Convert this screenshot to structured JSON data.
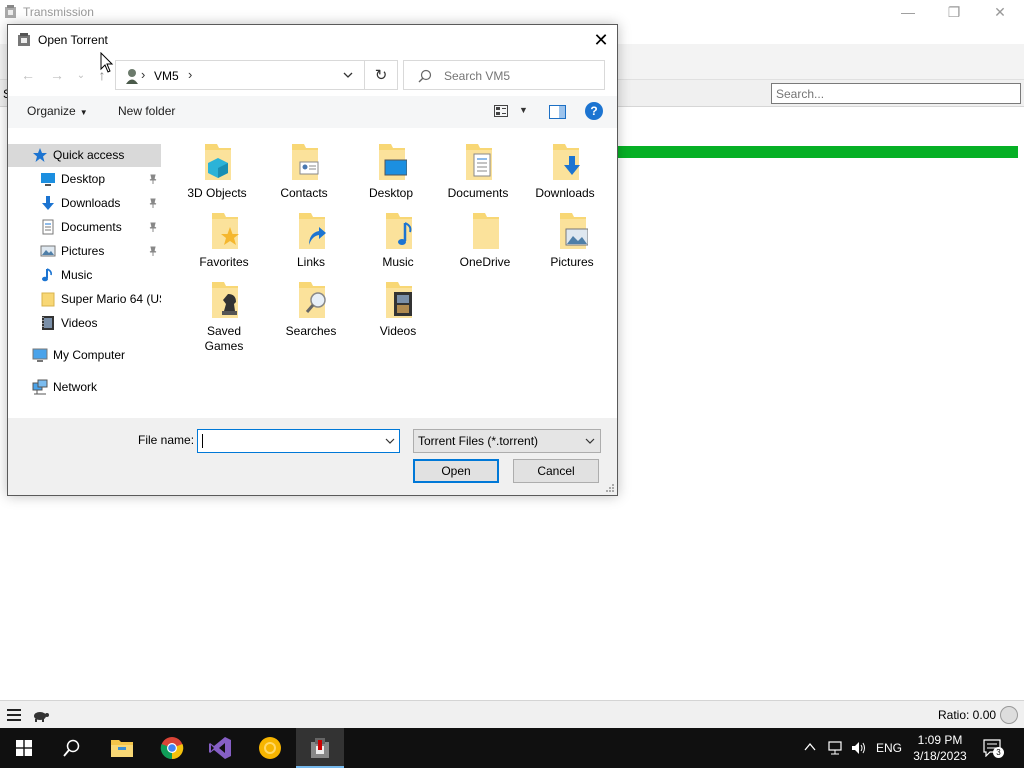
{
  "background_app": {
    "title": "Transmission",
    "filter_partial": "S",
    "search_placeholder": "Search...",
    "progress_fraction": 1.0,
    "ratio_text": "Ratio: 0.00",
    "accent": "#06b025"
  },
  "dialog": {
    "title": "Open Torrent",
    "close_label": "✕",
    "nav": {
      "back": "←",
      "forward": "→",
      "recent": "⌄",
      "up": "↑",
      "path_segment": "VM5",
      "sep": "›",
      "refresh": "↻",
      "search_placeholder": "Search VM5"
    },
    "commands": {
      "organize": "Organize",
      "organize_arrow": "▼",
      "new_folder": "New folder",
      "view_arrow": "▼",
      "help": "?"
    },
    "nav_pane": [
      {
        "label": "Quick access",
        "icon": "star-icon",
        "selected": true,
        "pinned": false
      },
      {
        "label": "Desktop",
        "icon": "desktop-icon",
        "pinned": true
      },
      {
        "label": "Downloads",
        "icon": "download-icon",
        "pinned": true
      },
      {
        "label": "Documents",
        "icon": "documents-icon",
        "pinned": true
      },
      {
        "label": "Pictures",
        "icon": "pictures-icon",
        "pinned": true
      },
      {
        "label": "Music",
        "icon": "music-icon",
        "pinned": false
      },
      {
        "label": "Super Mario 64 (US",
        "icon": "folder-icon",
        "pinned": false
      },
      {
        "label": "Videos",
        "icon": "videos-icon",
        "pinned": false
      },
      {
        "label": "My Computer",
        "icon": "computer-icon",
        "pinned": false
      },
      {
        "label": "Network",
        "icon": "network-icon",
        "pinned": false
      }
    ],
    "folders": [
      {
        "label": "3D Objects",
        "overlay": "cube"
      },
      {
        "label": "Contacts",
        "overlay": "contact-card"
      },
      {
        "label": "Desktop",
        "overlay": "monitor"
      },
      {
        "label": "Documents",
        "overlay": "document"
      },
      {
        "label": "Downloads",
        "overlay": "down-arrow"
      },
      {
        "label": "Favorites",
        "overlay": "star"
      },
      {
        "label": "Links",
        "overlay": "link-arrow"
      },
      {
        "label": "Music",
        "overlay": "note"
      },
      {
        "label": "OneDrive",
        "overlay": "none"
      },
      {
        "label": "Pictures",
        "overlay": "landscape"
      },
      {
        "label": "Saved\nGames",
        "overlay": "chess-piece"
      },
      {
        "label": "Searches",
        "overlay": "magnifier"
      },
      {
        "label": "Videos",
        "overlay": "film"
      }
    ],
    "bottom": {
      "file_name_label": "File name:",
      "file_name_value": "",
      "file_type": "Torrent Files (*.torrent)",
      "open_label": "Open",
      "cancel_label": "Cancel"
    }
  },
  "taskbar": {
    "apps": [
      "windows-start-icon",
      "search-icon",
      "file-explorer-icon",
      "chrome-icon",
      "visual-studio-icon",
      "yellow-app-icon",
      "transmission-icon"
    ],
    "language": "ENG",
    "time": "1:09 PM",
    "date": "3/18/2023",
    "notification_count": "3",
    "tray_chevron": "∧"
  }
}
